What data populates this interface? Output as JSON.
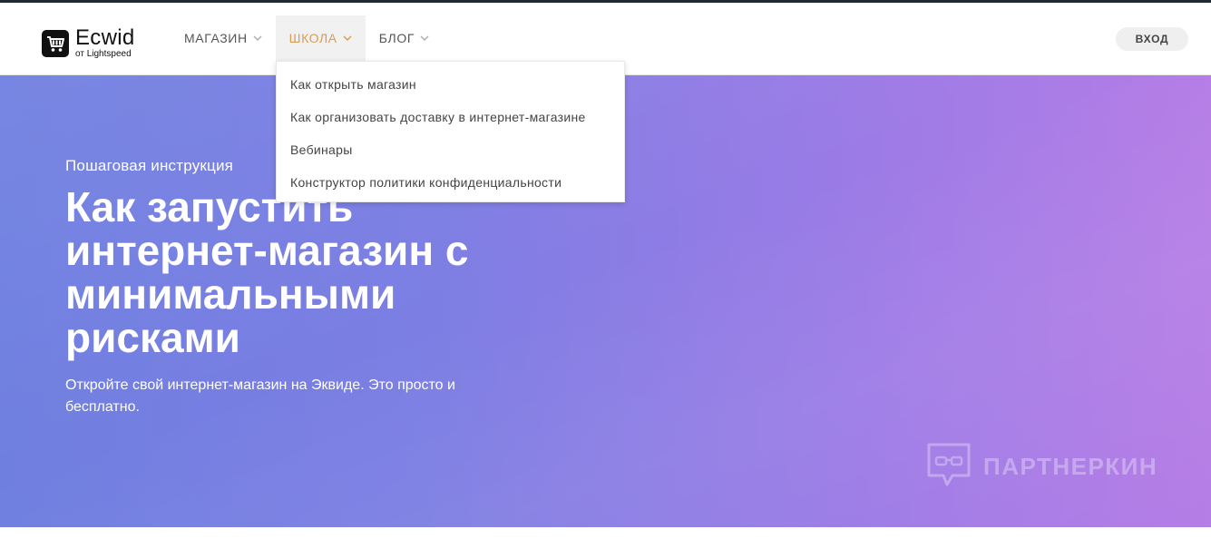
{
  "header": {
    "logo_name": "Ecwid",
    "logo_sub": "от Lightspeed",
    "nav": [
      {
        "label": "МАГАЗИН"
      },
      {
        "label": "ШКОЛА"
      },
      {
        "label": "БЛОГ"
      }
    ],
    "login_label": "ВХОД"
  },
  "dropdown": {
    "items": [
      "Как открыть магазин",
      "Как организовать доставку в интернет-магазине",
      "Вебинары",
      "Конструктор политики конфиденциальности"
    ]
  },
  "hero": {
    "eyebrow": "Пошаговая инструкция",
    "headline": "Как запустить интернет-магазин с минимальными рисками",
    "subtext": "Откройте свой интернет-магазин на Эквиде. Это просто и бесплатно.",
    "watermark": "ПАРТНЕРКИН"
  },
  "colors": {
    "accent": "#d99c57",
    "hero_left": "#6f7fe0",
    "hero_right": "#b57de6"
  }
}
